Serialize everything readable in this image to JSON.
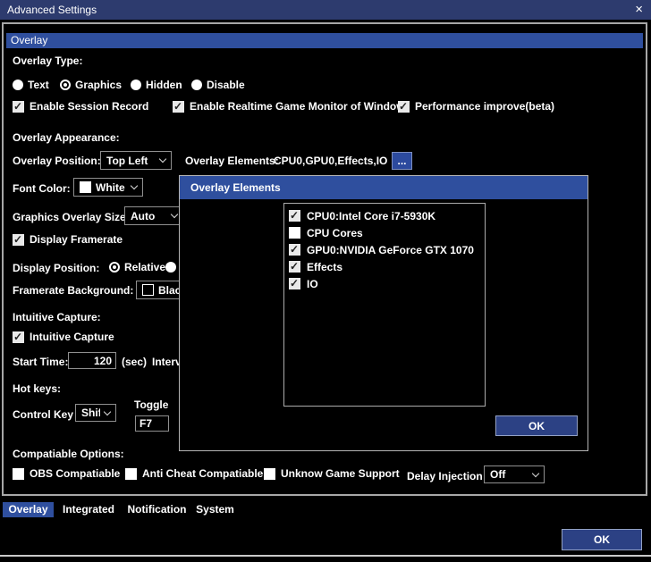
{
  "colors": {
    "title_bar": "#2d3b6e",
    "section_header_blue": "#2f4f9e",
    "button_blue": "#2c4184",
    "panel_border": "#a7a7a7",
    "background": "#000000",
    "text": "#ffffff"
  },
  "window": {
    "title": "Advanced Settings",
    "close_icon": "×"
  },
  "panel_header": "Overlay",
  "overlay_type": {
    "label": "Overlay Type:",
    "options": [
      {
        "label": "Text",
        "selected": false
      },
      {
        "label": "Graphics",
        "selected": true
      },
      {
        "label": "Hidden",
        "selected": false
      },
      {
        "label": "Disable",
        "selected": false
      }
    ]
  },
  "record_options": [
    {
      "label": "Enable Session Record",
      "checked": true
    },
    {
      "label": "Enable Realtime Game Monitor of Window",
      "checked": true
    },
    {
      "label": "Performance improve(beta)",
      "checked": true
    }
  ],
  "appearance": {
    "header": "Overlay Appearance:",
    "position_label": "Overlay Position:",
    "position_value": "Top Left",
    "elements_label": "Overlay Elements:",
    "elements_value": "CPU0,GPU0,Effects,IO",
    "more_button": "...",
    "font_color_label": "Font Color:",
    "font_color_value": "White",
    "size_label": "Graphics Overlay Size:",
    "size_value": "Auto"
  },
  "framerate": {
    "display_checkbox": {
      "label": "Display Framerate",
      "checked": true
    },
    "position_label": "Display Position:",
    "position_options": [
      {
        "label": "Relative",
        "selected": true
      },
      {
        "label": "",
        "selected": false
      }
    ],
    "background_label": "Framerate Background:",
    "background_value": "Black"
  },
  "capture": {
    "header": "Intuitive Capture:",
    "checkbox": {
      "label": "Intuitive Capture",
      "checked": true
    },
    "start_label": "Start Time:",
    "start_value": "120",
    "start_unit": "(sec)",
    "interval_label": "Interval"
  },
  "hotkeys": {
    "header": "Hot keys:",
    "control_label": "Control Key",
    "control_value": "Shift",
    "toggle_label": "Toggle",
    "toggle_value": "F7"
  },
  "compat": {
    "header": "Compatiable Options:",
    "options": [
      {
        "label": "OBS Compatiable",
        "checked": false
      },
      {
        "label": "Anti Cheat Compatiable",
        "checked": false
      },
      {
        "label": "Unknow Game Support",
        "checked": false
      }
    ],
    "delay_label": "Delay Injection",
    "delay_value": "Off"
  },
  "popup": {
    "title": "Overlay Elements",
    "items": [
      {
        "label": "CPU0:Intel Core i7-5930K",
        "checked": true
      },
      {
        "label": "CPU Cores",
        "checked": false
      },
      {
        "label": "GPU0:NVIDIA GeForce GTX 1070",
        "checked": true
      },
      {
        "label": "Effects",
        "checked": true
      },
      {
        "label": "IO",
        "checked": true
      }
    ],
    "ok_label": "OK"
  },
  "tabs": [
    {
      "label": "Overlay",
      "selected": true
    },
    {
      "label": "Integrated",
      "selected": false
    },
    {
      "label": "Notification",
      "selected": false
    },
    {
      "label": "System",
      "selected": false
    }
  ],
  "footer": {
    "ok_label": "OK"
  }
}
